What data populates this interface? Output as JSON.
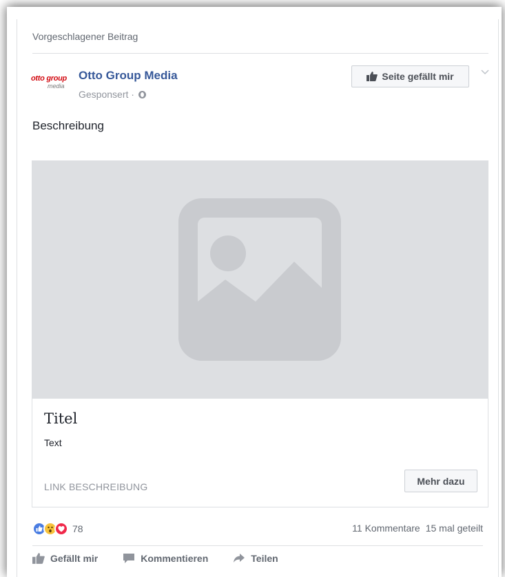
{
  "header": {
    "suggested_label": "Vorgeschlagener Beitrag"
  },
  "page": {
    "logo_text_main": "otto group",
    "logo_text_sub": "media",
    "name": "Otto Group Media",
    "sponsored": "Gesponsert ·",
    "like_page_label": "Seite gefällt mir"
  },
  "post": {
    "description": "Beschreibung"
  },
  "link": {
    "title": "Titel",
    "text": "Text",
    "description": "LINK BESCHREIBUNG",
    "cta_label": "Mehr dazu"
  },
  "engagement": {
    "reaction_count": "78",
    "comments": "11 Kommentare",
    "shares": "15 mal geteilt"
  },
  "actions": {
    "like": "Gefällt mir",
    "comment": "Kommentieren",
    "share": "Teilen"
  },
  "colors": {
    "link_blue": "#365899",
    "logo_red": "#d20a11",
    "placeholder_bg": "#dddfe2",
    "like_blue": "#4a7de2",
    "wow_yellow": "#f7c23b",
    "love_red": "#f0284a"
  },
  "icons": {
    "placeholder": "image-placeholder-icon",
    "globe": "globe-icon",
    "thumb": "thumbs-up-icon",
    "comment": "comment-icon",
    "share": "share-arrow-icon",
    "menu": "chevron-down-icon"
  }
}
